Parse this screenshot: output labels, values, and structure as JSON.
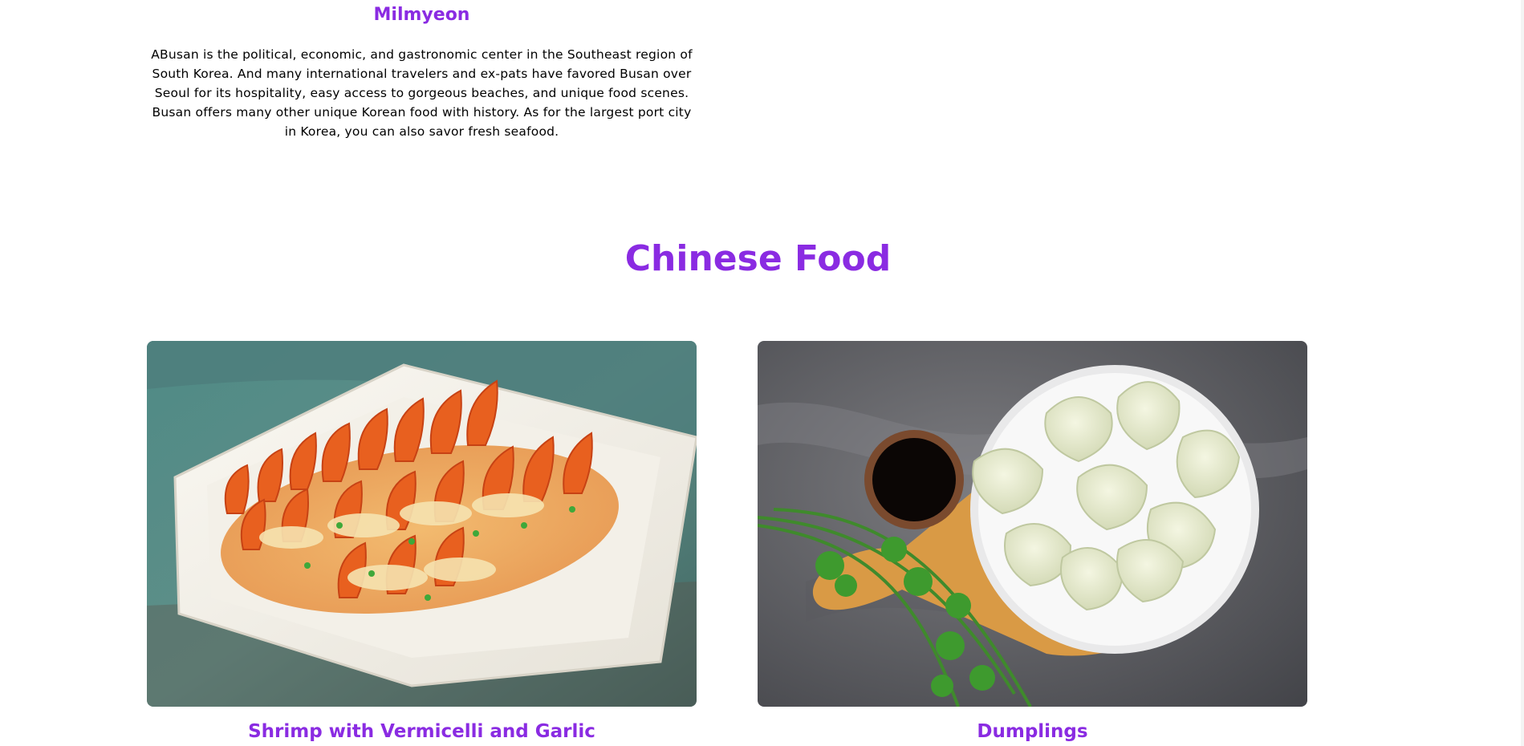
{
  "korean_item": {
    "name": "Milmyeon",
    "description": "ABusan is the political, economic, and gastronomic center in the Southeast region of South Korea. And many international travelers and ex-pats have favored Busan over Seoul for its hospitality, easy access to gorgeous beaches, and unique food scenes. Busan offers many other unique Korean food with history. As for the largest port city in Korea, you can also savor fresh seafood."
  },
  "chinese_section": {
    "title": "Chinese Food",
    "items": [
      {
        "name": "Shrimp with Vermicelli and Garlic",
        "image": "shrimp-dish-photo"
      },
      {
        "name": "Dumplings",
        "image": "dumplings-photo"
      }
    ]
  },
  "colors": {
    "accent": "#8a2be2",
    "text": "#000000",
    "background": "#ffffff"
  }
}
